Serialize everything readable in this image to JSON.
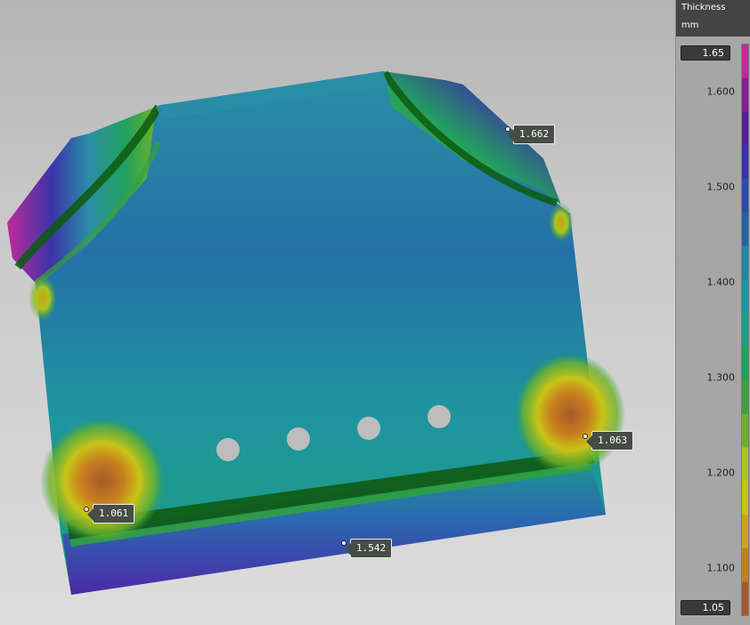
{
  "legend": {
    "title": "Thickness",
    "unit": "mm",
    "max_value": "1.65",
    "min_value": "1.05",
    "ticks": [
      {
        "label": "1.600",
        "value": 1.6
      },
      {
        "label": "1.500",
        "value": 1.5
      },
      {
        "label": "1.400",
        "value": 1.4
      },
      {
        "label": "1.300",
        "value": 1.3
      },
      {
        "label": "1.200",
        "value": 1.2
      },
      {
        "label": "1.100",
        "value": 1.1
      }
    ],
    "colors_bottom_to_top": [
      "#a65a2a",
      "#c87f1f",
      "#cda21e",
      "#c8c416",
      "#a9c520",
      "#6bb22b",
      "#3ea23a",
      "#23a15c",
      "#1d9d84",
      "#1c95a3",
      "#1e86a8",
      "#2165a8",
      "#2a4bab",
      "#3a33a8",
      "#571f9c",
      "#8a1d96",
      "#c02a9b"
    ]
  },
  "probes": [
    {
      "label": "1.662"
    },
    {
      "label": "1.063"
    },
    {
      "label": "1.061"
    },
    {
      "label": "1.542"
    }
  ]
}
